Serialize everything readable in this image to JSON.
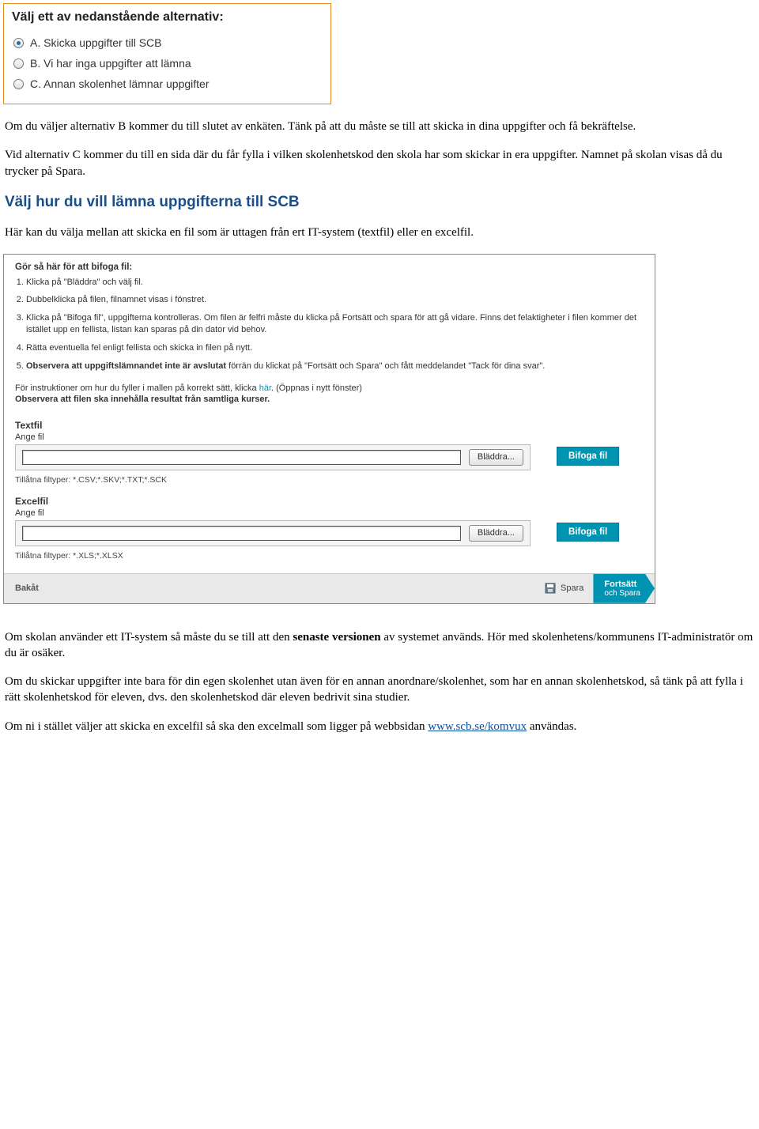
{
  "optionBox": {
    "title": "Välj ett av nedanstående alternativ:",
    "options": [
      {
        "label": "A. Skicka uppgifter till SCB",
        "selected": true
      },
      {
        "label": "B. Vi har inga uppgifter att lämna",
        "selected": false
      },
      {
        "label": "C. Annan skolenhet lämnar uppgifter",
        "selected": false
      }
    ]
  },
  "p1": "Om du väljer alternativ B kommer du till slutet av enkäten. Tänk på att du måste se till att skicka in dina uppgifter och få bekräftelse.",
  "p2": "Vid alternativ C kommer du till en sida där du får fylla i vilken skolenhetskod den skola har som skickar in era uppgifter. Namnet på skolan visas då du trycker på Spara.",
  "h1": "Välj hur du vill lämna uppgifterna till SCB",
  "p3": "Här kan du välja mellan att skicka en fil som är uttagen från ert IT-system (textfil) eller en excelfil.",
  "formPanel": {
    "instrTitle": "Gör så här för att bifoga fil:",
    "steps": [
      "Klicka på \"Bläddra\" och välj fil.",
      "Dubbelklicka på filen, filnamnet visas i fönstret.",
      "Klicka på \"Bifoga fil\", uppgifterna kontrolleras. Om filen är felfri måste du klicka på Fortsätt och spara för att gå vidare. Finns det felaktigheter i filen kommer det istället upp en fellista, listan kan sparas på din dator vid behov.",
      "Rätta eventuella fel enligt fellista och skicka in filen på nytt."
    ],
    "step5_bold": "Observera att uppgiftslämnandet inte är avslutat",
    "step5_rest": " förrän du klickat på \"Fortsätt och Spara\" och fått meddelandet \"Tack för dina svar\".",
    "hintLine_pre": "För instruktioner om hur du fyller i mallen på korrekt sätt, klicka ",
    "hintLine_link": "här",
    "hintLine_post": ". (Öppnas i nytt fönster)",
    "hintBold": "Observera att filen ska innehålla resultat från samtliga kurser.",
    "textfil": {
      "header": "Textfil",
      "label": "Ange fil",
      "browse": "Bläddra...",
      "attach": "Bifoga fil",
      "allowed": "Tillåtna filtyper: *.CSV;*.SKV;*.TXT;*.SCK"
    },
    "excelfil": {
      "header": "Excelfil",
      "label": "Ange fil",
      "browse": "Bläddra...",
      "attach": "Bifoga fil",
      "allowed": "Tillåtna filtyper: *.XLS;*.XLSX"
    },
    "footer": {
      "back": "Bakåt",
      "save": "Spara",
      "continue1": "Fortsätt",
      "continue2": "och Spara"
    }
  },
  "p4_pre": "Om skolan använder ett IT-system så måste du se till att den ",
  "p4_bold": "senaste versionen",
  "p4_post": " av systemet används. Hör med skolenhetens/kommunens IT-administratör om du är osäker.",
  "p5": "Om du skickar uppgifter inte bara för din egen skolenhet utan även för en annan anordnare/skolenhet, som har en annan skolenhetskod, så tänk på att fylla i rätt sko­lenhetskod för eleven, dvs. den skolenhetskod där eleven bedrivit sina studier.",
  "p6_pre": "Om ni i stället väljer att skicka en excelfil så ska den excelmall som ligger på webbsidan ",
  "p6_link": "www.scb.se/komvux",
  "p6_post": " användas."
}
